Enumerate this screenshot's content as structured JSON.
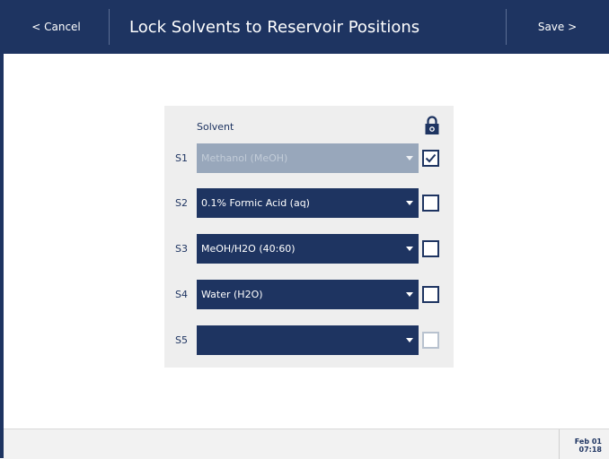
{
  "header": {
    "cancel_label": "< Cancel",
    "title": "Lock Solvents to Reservoir Positions",
    "save_label": "Save >"
  },
  "panel": {
    "column_label": "Solvent",
    "rows": [
      {
        "label": "S1",
        "value": "Methanol (MeOH)",
        "locked": true,
        "disabled": true
      },
      {
        "label": "S2",
        "value": "0.1% Formic Acid (aq)",
        "locked": false,
        "disabled": false
      },
      {
        "label": "S3",
        "value": "MeOH/H2O (40:60)",
        "locked": false,
        "disabled": false
      },
      {
        "label": "S4",
        "value": "Water (H2O)",
        "locked": false,
        "disabled": false
      },
      {
        "label": "S5",
        "value": "",
        "locked": false,
        "disabled": false,
        "checkbox_disabled": true
      }
    ]
  },
  "footer": {
    "date": "Feb 01",
    "time": "07:18"
  },
  "colors": {
    "primary": "#1e3461",
    "disabled_select": "#98a7bb",
    "panel_bg": "#eeeeee"
  }
}
